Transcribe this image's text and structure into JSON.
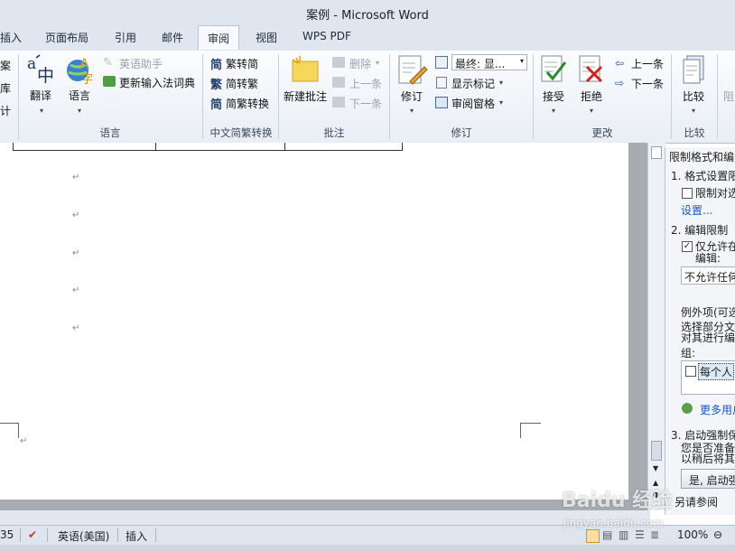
{
  "window": {
    "title": "案例 - Microsoft Word"
  },
  "tabs": [
    {
      "label": "插入"
    },
    {
      "label": "页面布局"
    },
    {
      "label": "引用"
    },
    {
      "label": "邮件"
    },
    {
      "label": "审阅",
      "active": true
    },
    {
      "label": "视图"
    },
    {
      "label": "WPS PDF"
    }
  ],
  "ribbon": {
    "left_partial": {
      "items": [
        "案",
        "库",
        "计"
      ]
    },
    "language": {
      "group_label": "语言",
      "translate": "翻译",
      "language": "语言",
      "english_assistant": "英语助手",
      "update_ime": "更新输入法词典"
    },
    "chinese_conversion": {
      "group_label": "中文简繁转换",
      "trad_to_simp": "繁转简",
      "simp_to_trad": "简转繁",
      "conversion": "简繁转换"
    },
    "comments": {
      "group_label": "批注",
      "new_comment": "新建批注",
      "delete": "删除",
      "previous": "上一条",
      "next": "下一条"
    },
    "tracking": {
      "group_label": "修订",
      "track_changes": "修订",
      "display_for_review": "最终: 显...",
      "show_markup": "显示标记",
      "reviewing_pane": "审阅窗格"
    },
    "changes": {
      "group_label": "更改",
      "accept": "接受",
      "reject": "拒绝",
      "previous": "上一条",
      "next": "下一条"
    },
    "compare": {
      "group_label": "比较",
      "compare": "比较"
    },
    "protect_partial": {
      "label": "阻"
    }
  },
  "document": {
    "paragraph_mark": "↵"
  },
  "restrict_pane": {
    "title": "限制格式和编",
    "section1": "1. 格式设置限",
    "limit_format_checkbox": "限制对选",
    "settings_link": "设置...",
    "section2": "2. 编辑限制",
    "allow_only_checkbox": "仅允许在",
    "edit_label": "编辑:",
    "edit_dropdown": "不允许任何",
    "exceptions_label": "例外项(可选",
    "select_parts": [
      "选择部分文",
      "对其进行编",
      "组:"
    ],
    "everyone": "每个人",
    "more_users_link": "更多用户",
    "section3": "3. 启动强制保",
    "ready_text": [
      "您是否准备",
      "以稍后将其"
    ],
    "start_button": "是, 启动强",
    "see_also": "另请参阅"
  },
  "statusbar": {
    "page_count": "35",
    "language": "英语(美国)",
    "mode": "插入",
    "zoom": "100%"
  },
  "watermark": {
    "brand": "Baidu 经验",
    "url": "jingyan.baidu.com"
  },
  "colors": {
    "ribbon_bg": "#e9eef5",
    "accent_link": "#1a57b8",
    "title_bg": "#dfe6ef"
  }
}
